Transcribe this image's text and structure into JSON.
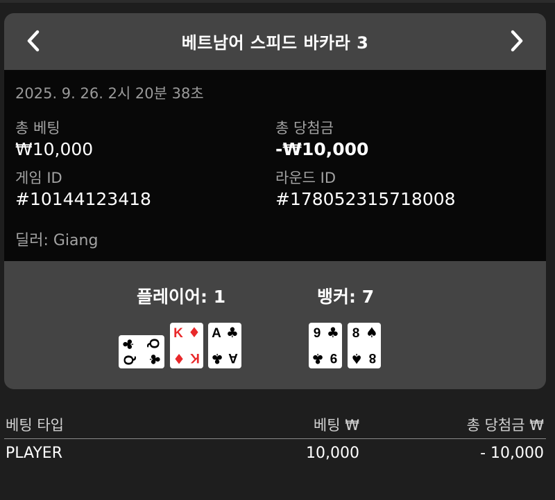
{
  "header": {
    "title": "베트남어 스피드 바카라 3"
  },
  "summary": {
    "timestamp": "2025. 9. 26. 2시 20분 38초",
    "total_bet_label": "총 베팅",
    "total_bet_value": "₩10,000",
    "total_win_label": "총 당첨금",
    "total_win_value": "-₩10,000",
    "game_id_label": "게임 ID",
    "game_id_value": "#10144123418",
    "round_id_label": "라운드 ID",
    "round_id_value": "#178052315718008",
    "dealer": "딜러: Giang"
  },
  "hands": {
    "player_label": "플레이어: 1",
    "banker_label": "뱅커: 7",
    "player_cards": [
      {
        "rank": "Q",
        "suit": "♣",
        "color": "#000000",
        "rotated": true
      },
      {
        "rank": "K",
        "suit": "♦",
        "color": "#e8282a",
        "rotated": false
      },
      {
        "rank": "A",
        "suit": "♣",
        "color": "#000000",
        "rotated": false
      }
    ],
    "banker_cards": [
      {
        "rank": "9",
        "suit": "♣",
        "color": "#000000",
        "rotated": false
      },
      {
        "rank": "8",
        "suit": "♠",
        "color": "#000000",
        "rotated": false
      }
    ]
  },
  "bets_table": {
    "headers": [
      "베팅 타입",
      "베팅 ₩",
      "총 당첨금 ₩"
    ],
    "rows": [
      [
        "PLAYER",
        "10,000",
        "- 10,000"
      ]
    ]
  },
  "colors": {
    "panel": "#444444",
    "info_bg": "#080808",
    "page_bg": "#1e1e1e",
    "red_suit": "#e8282a"
  }
}
